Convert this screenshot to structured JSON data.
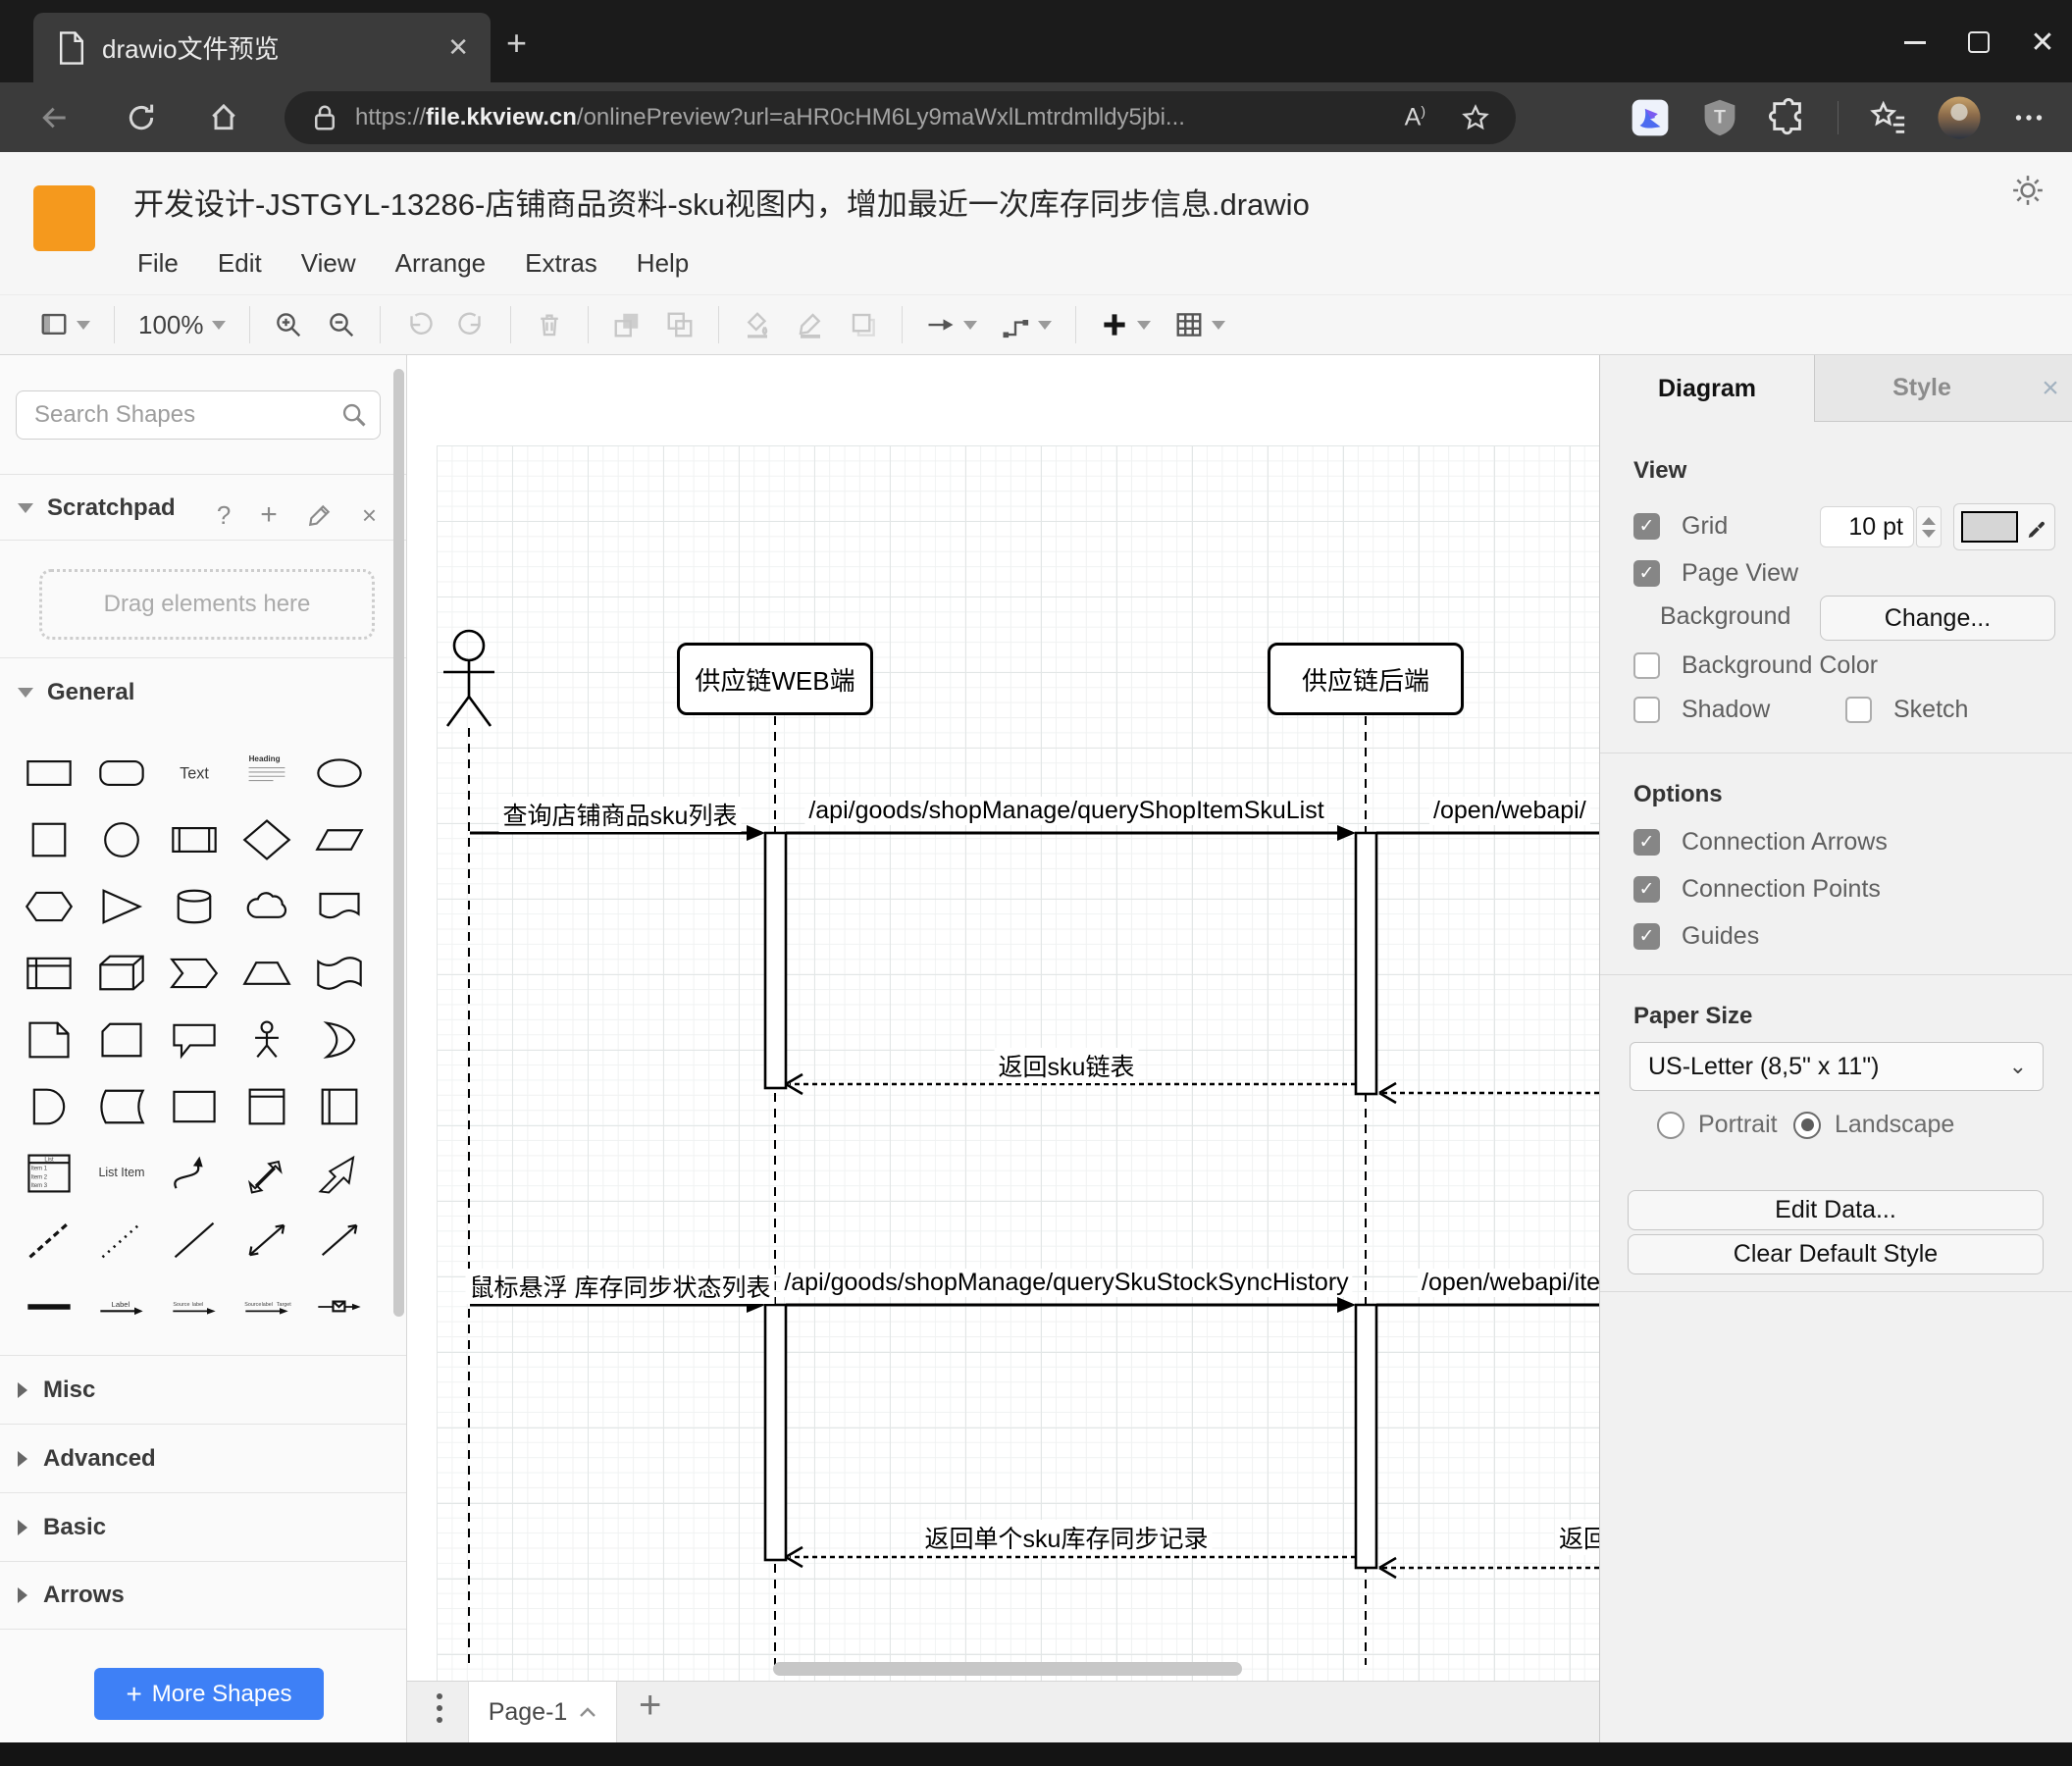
{
  "browser": {
    "tab_title": "drawio文件预览",
    "tab_close": "✕",
    "new_tab": "+",
    "url_scheme": "https://",
    "url_host": "file.kkview.cn",
    "url_path": "/onlinePreview?url=aHR0cHM6Ly9maWxlLmtrdmlldy5jbi...",
    "nav_icons": [
      "back-icon",
      "reload-icon",
      "home-icon",
      "lock-icon",
      "read-aloud-icon",
      "favorite-star-icon"
    ],
    "extension_icons": [
      "thunder-bird-extension-icon",
      "tampermonkey-shield-icon",
      "extensions-puzzle-icon",
      "collections-icon",
      "profile-avatar",
      "more-menu-icon"
    ],
    "window_icons": [
      "minimize-icon",
      "maximize-icon",
      "close-icon"
    ]
  },
  "app": {
    "title": "开发设计-JSTGYL-13286-店铺商品资料-sku视图内，增加最近一次库存同步信息.drawio",
    "menus": [
      "File",
      "Edit",
      "View",
      "Arrange",
      "Extras",
      "Help"
    ],
    "theme_icon": "sun-icon",
    "toolbar": {
      "zoom_level": "100%",
      "items_left": [
        {
          "icon": "page-view",
          "caret": true,
          "enabled": true
        },
        {
          "sep": true
        },
        {
          "zoom": true,
          "caret": true
        },
        {
          "sep": true
        },
        {
          "icon": "zoom-in",
          "enabled": true
        },
        {
          "icon": "zoom-out",
          "enabled": true
        },
        {
          "sep": true
        },
        {
          "icon": "undo",
          "enabled": false
        },
        {
          "icon": "redo",
          "enabled": false
        },
        {
          "sep": true
        },
        {
          "icon": "delete",
          "enabled": false
        },
        {
          "sep": true
        },
        {
          "icon": "to-front",
          "enabled": false
        },
        {
          "icon": "to-back",
          "enabled": false
        },
        {
          "sep": true
        },
        {
          "icon": "fill-color",
          "enabled": false
        },
        {
          "icon": "line-color",
          "enabled": false
        },
        {
          "icon": "shadow",
          "enabled": false
        },
        {
          "sep": true
        },
        {
          "icon": "connection",
          "caret": true,
          "enabled": true
        },
        {
          "icon": "waypoints",
          "caret": true,
          "enabled": true
        },
        {
          "sep": true
        },
        {
          "icon": "insert",
          "caret": true,
          "enabled": true,
          "strong": true
        },
        {
          "icon": "table",
          "caret": true,
          "enabled": true
        }
      ],
      "items_right": [
        "fullscreen",
        "format-panel",
        "collapse"
      ]
    }
  },
  "sidebar": {
    "search_placeholder": "Search Shapes",
    "scratchpad_title": "Scratchpad",
    "scratchpad_icons": [
      "help-icon",
      "add-icon",
      "edit-pencil-icon",
      "close-icon"
    ],
    "scratchpad_hint": "Drag elements here",
    "general_title": "General",
    "shapes": [
      "rectangle",
      "rounded-rectangle",
      "text",
      "textbox",
      "ellipse",
      "square",
      "circle",
      "process",
      "diamond",
      "parallelogram",
      "hexagon",
      "triangle",
      "cylinder",
      "cloud",
      "document",
      "internal-storage",
      "cube",
      "step",
      "trapezoid",
      "tape",
      "note",
      "card",
      "callout",
      "actor",
      "or",
      "and",
      "data-storage",
      "container",
      "vertical-container",
      "horizontal-container",
      "list",
      "list-item",
      "curve",
      "bidirectional-arrow",
      "arrow",
      "dashed-line",
      "dotted-line",
      "line",
      "bidirectional-connector",
      "directional-connector",
      "horizontal-line",
      "arrow-with-label",
      "labeled-arrow",
      "double-labeled-arrow",
      "envelope-link"
    ],
    "shape_texts": {
      "text": "Text",
      "heading": "Heading",
      "list": "List",
      "list_item": "List Item",
      "label": "Label"
    },
    "sections": [
      "Misc",
      "Advanced",
      "Basic",
      "Arrows"
    ],
    "more_shapes": "More Shapes"
  },
  "canvas": {
    "participants": [
      "供应链WEB端",
      "供应链后端"
    ],
    "messages": {
      "m1": "查询店铺商品sku列表",
      "m2": "/api/goods/shopManage/queryShopItemSkuList",
      "m3": "/open/webapi/",
      "r1": "返回sku链表",
      "m4": "鼠标悬浮 库存同步状态列表",
      "m5": "/api/goods/shopManage/querySkuStockSyncHistory",
      "m6": "/open/webapi/item",
      "r2": "返回单个sku库存同步记录",
      "r3": "返回"
    }
  },
  "panel": {
    "tabs": [
      "Diagram",
      "Style"
    ],
    "close_icon": "×",
    "view": {
      "heading": "View",
      "grid": "Grid",
      "grid_size": "10 pt",
      "page_view": "Page View",
      "background": "Background",
      "change": "Change...",
      "background_color": "Background Color",
      "shadow": "Shadow",
      "sketch": "Sketch",
      "grid_color": "#d6d6d6"
    },
    "options": {
      "heading": "Options",
      "items": [
        "Connection Arrows",
        "Connection Points",
        "Guides"
      ]
    },
    "paper": {
      "heading": "Paper Size",
      "size": "US-Letter (8,5\" x 11\")",
      "portrait": "Portrait",
      "landscape": "Landscape"
    },
    "actions": [
      "Edit Data...",
      "Clear Default Style"
    ]
  },
  "pagebar": {
    "page": "Page-1"
  },
  "colors": {
    "accent_blue": "#3e80f6",
    "logo_orange": "#f5991d",
    "browser_dark": "#1b1b1b"
  }
}
